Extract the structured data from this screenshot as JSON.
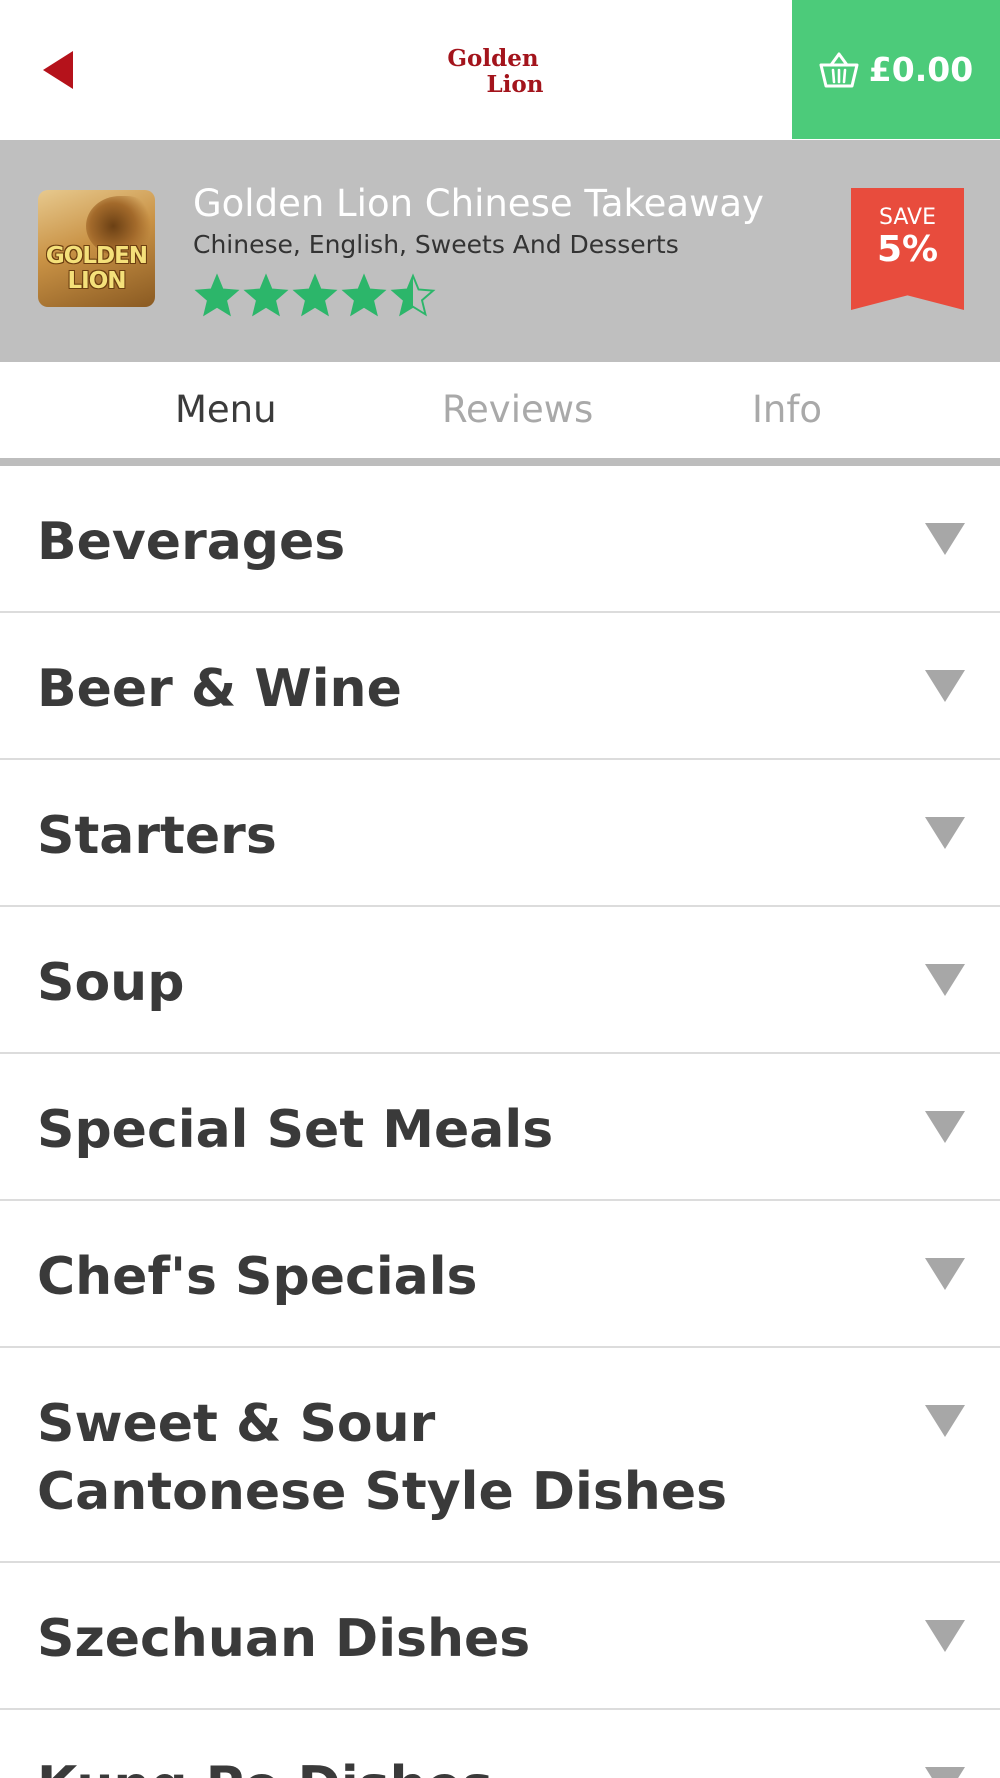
{
  "topbar": {
    "logo_line1": "Golden",
    "logo_line2": "Lion",
    "basket_total": "£0.00"
  },
  "restaurant": {
    "thumbnail_line1": "GOLDEN",
    "thumbnail_line2": "LION",
    "name": "Golden Lion Chinese Takeaway",
    "cuisines": "Chinese, English, Sweets And Desserts",
    "rating": 4.5,
    "rating_max": 5,
    "star_color": "#2cb66a",
    "save_label": "SAVE",
    "save_value": "5%"
  },
  "tabs": [
    {
      "label": "Menu",
      "active": true
    },
    {
      "label": "Reviews",
      "active": false
    },
    {
      "label": "Info",
      "active": false
    }
  ],
  "categories": [
    {
      "label": "Beverages"
    },
    {
      "label": "Beer & Wine"
    },
    {
      "label": "Starters"
    },
    {
      "label": "Soup"
    },
    {
      "label": "Special Set Meals"
    },
    {
      "label": "Chef's Specials"
    },
    {
      "label": "Sweet & Sour Cantonese Style Dishes"
    },
    {
      "label": "Szechuan Dishes"
    },
    {
      "label": "Kung Po Dishes"
    }
  ],
  "colors": {
    "brand_red": "#b5121b",
    "basket_green": "#4ccb7a",
    "save_red": "#e84c3d",
    "header_grey": "#bfbfbf"
  }
}
